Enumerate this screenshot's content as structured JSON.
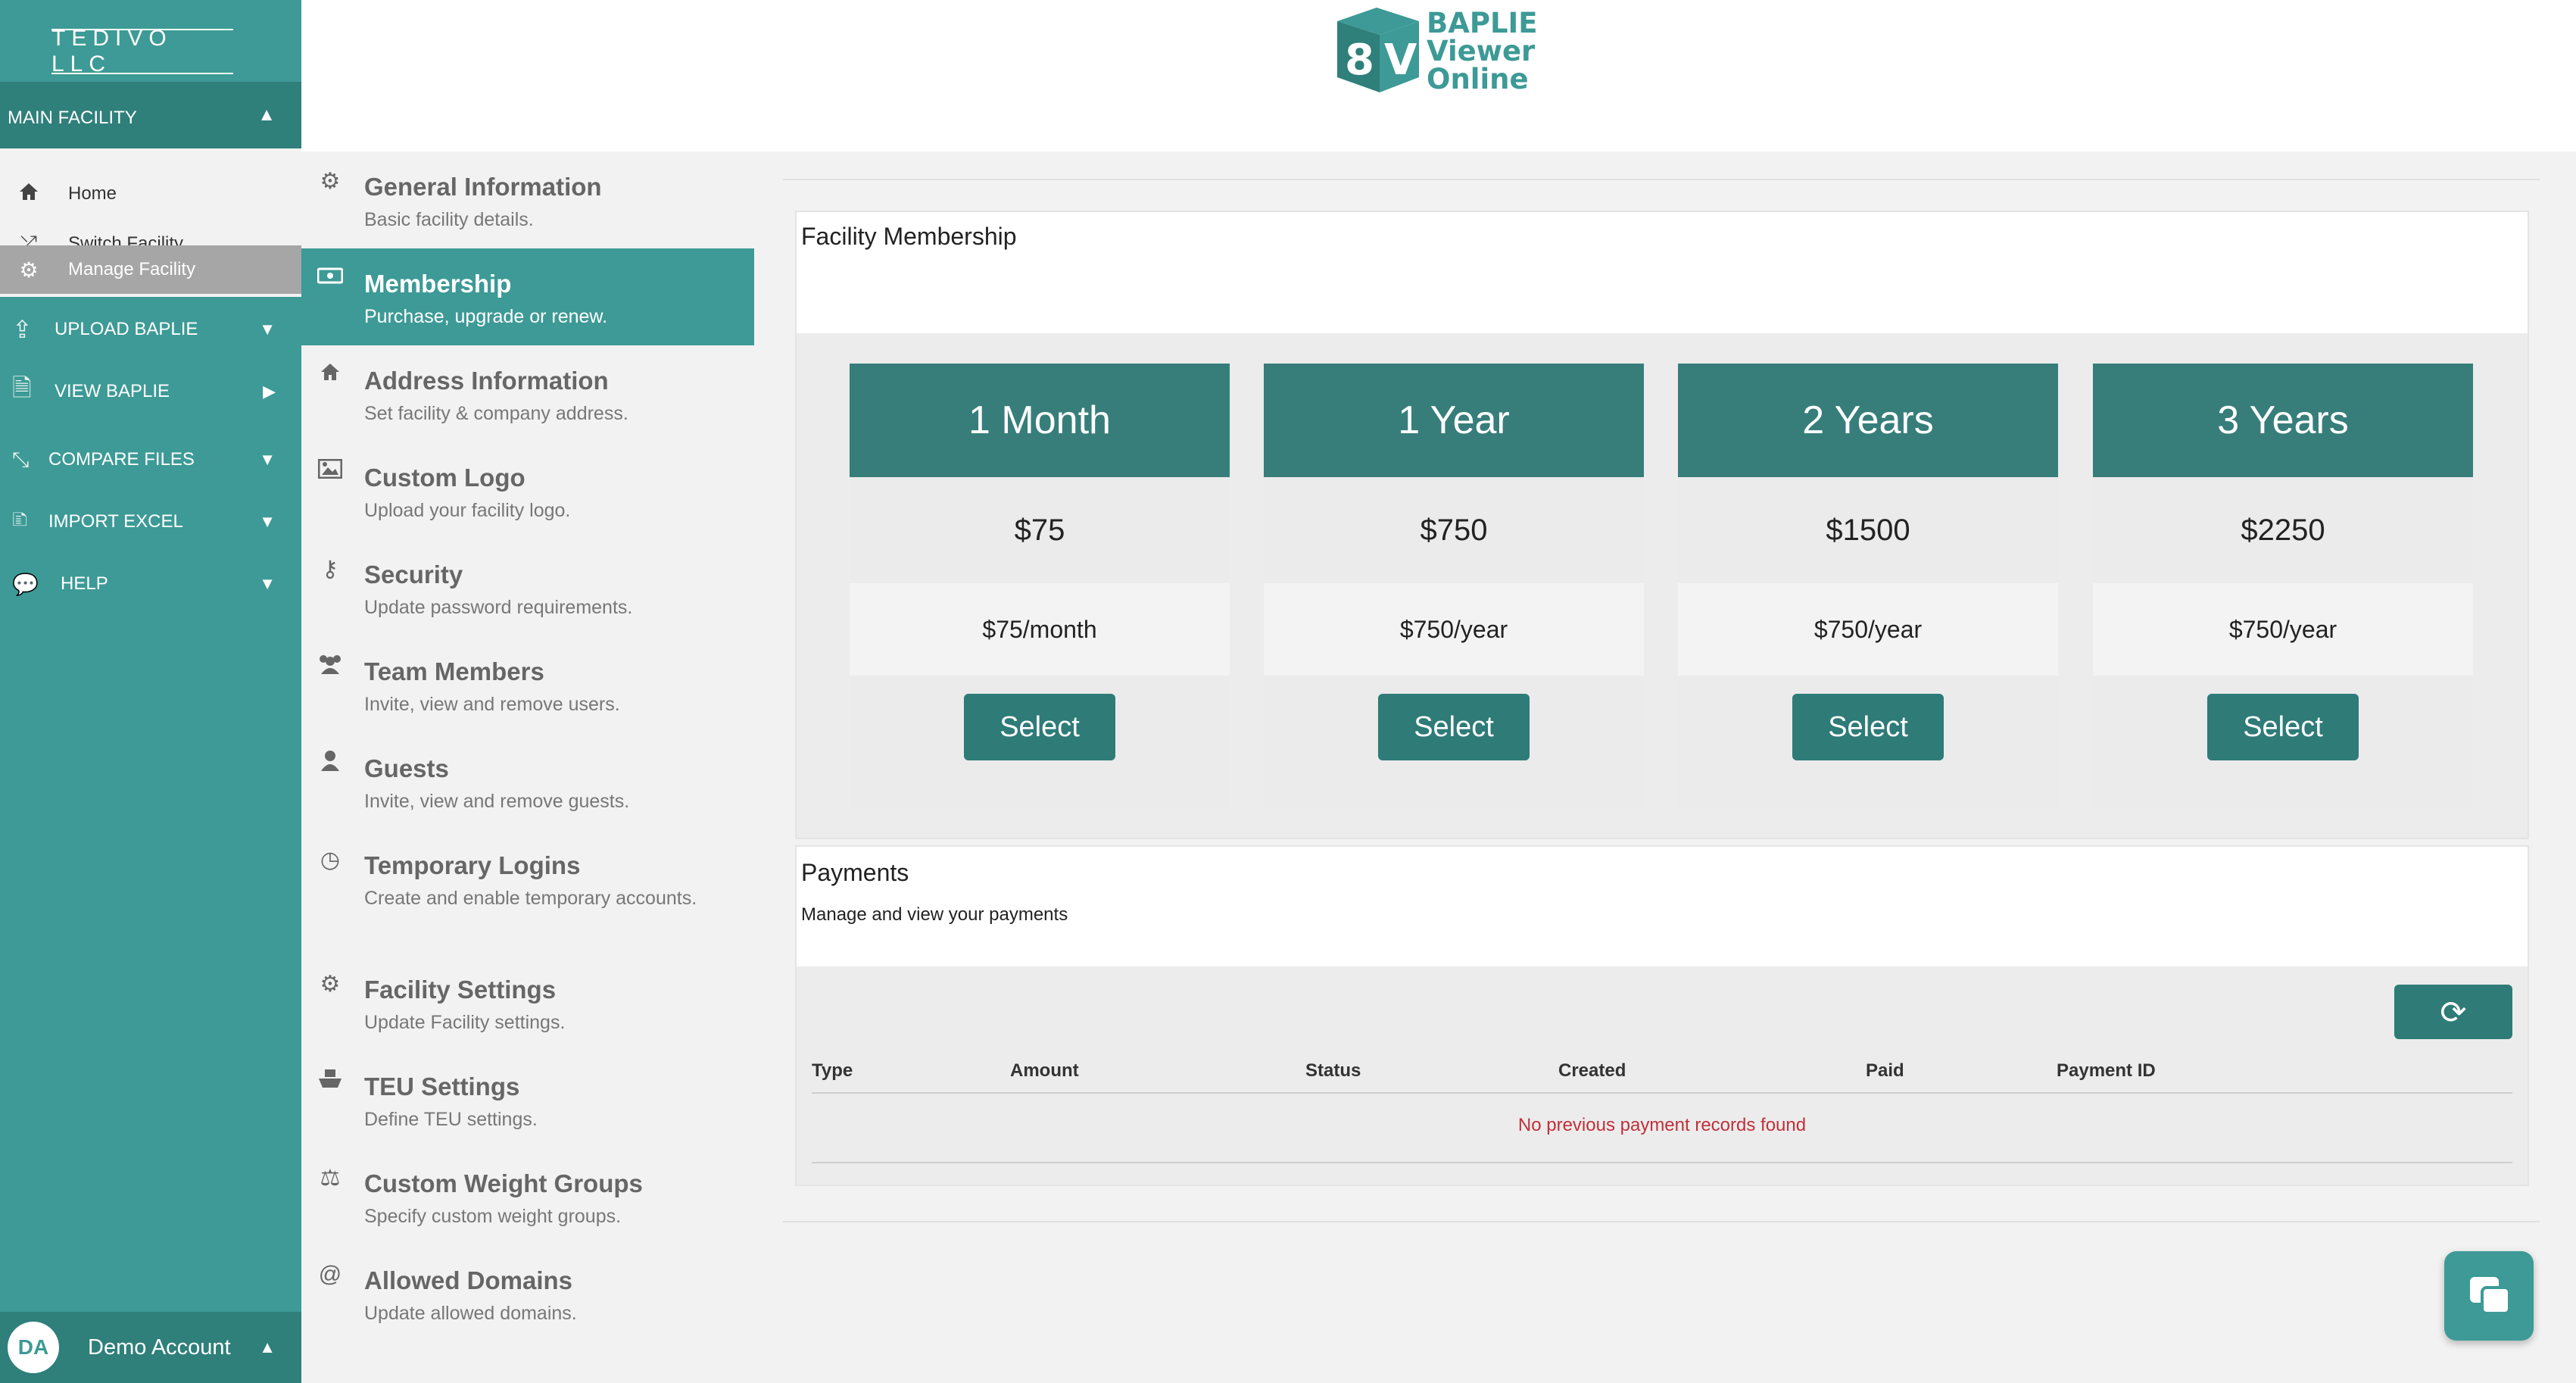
{
  "sidebar": {
    "brand": "TEDIVO LLC",
    "facility_label": "MAIN FACILITY",
    "facility_items": [
      {
        "label": "Home",
        "icon": "home-icon"
      },
      {
        "label": "Switch Facility",
        "icon": "shuffle-icon"
      },
      {
        "label": "Manage Facility",
        "icon": "gears-icon",
        "active": true
      }
    ],
    "sections": [
      {
        "label": "UPLOAD BAPLIE",
        "icon": "upload-icon"
      },
      {
        "label": "VIEW BAPLIE",
        "icon": "document-icon"
      },
      {
        "label": "COMPARE FILES",
        "icon": "compress-icon"
      },
      {
        "label": "IMPORT EXCEL",
        "icon": "excel-icon"
      },
      {
        "label": "HELP",
        "icon": "chat-bubbles-icon"
      }
    ],
    "user": {
      "initials": "DA",
      "name": "Demo Account"
    }
  },
  "header": {
    "logo_text": [
      "BAPLIE",
      "Viewer",
      "Online"
    ]
  },
  "settings_menu": [
    {
      "title": "General Information",
      "desc": "Basic facility details.",
      "icon": "gear-icon"
    },
    {
      "title": "Membership",
      "desc": "Purchase, upgrade or renew.",
      "icon": "money-icon",
      "active": true
    },
    {
      "title": "Address Information",
      "desc": "Set facility & company address.",
      "icon": "home-icon"
    },
    {
      "title": "Custom Logo",
      "desc": "Upload your facility logo.",
      "icon": "image-icon"
    },
    {
      "title": "Security",
      "desc": "Update password requirements.",
      "icon": "key-icon"
    },
    {
      "title": "Team Members",
      "desc": "Invite, view and remove users.",
      "icon": "users-icon"
    },
    {
      "title": "Guests",
      "desc": "Invite, view and remove guests.",
      "icon": "user-icon"
    },
    {
      "title": "Temporary Logins",
      "desc": "Create and enable temporary accounts.",
      "icon": "clock-icon"
    },
    {
      "title": "Facility Settings",
      "desc": "Update Facility settings.",
      "icon": "gears-icon"
    },
    {
      "title": "TEU Settings",
      "desc": "Define TEU settings.",
      "icon": "ship-icon"
    },
    {
      "title": "Custom Weight Groups",
      "desc": "Specify custom weight groups.",
      "icon": "scale-icon"
    },
    {
      "title": "Allowed Domains",
      "desc": "Update allowed domains.",
      "icon": "at-icon"
    }
  ],
  "membership": {
    "title": "Facility Membership",
    "plans": [
      {
        "name": "1 Month",
        "price": "$75",
        "rate": "$75/month",
        "button": "Select"
      },
      {
        "name": "1 Year",
        "price": "$750",
        "rate": "$750/year",
        "button": "Select"
      },
      {
        "name": "2 Years",
        "price": "$1500",
        "rate": "$750/year",
        "button": "Select"
      },
      {
        "name": "3 Years",
        "price": "$2250",
        "rate": "$750/year",
        "button": "Select"
      }
    ]
  },
  "payments": {
    "title": "Payments",
    "subtitle": "Manage and view your payments",
    "columns": [
      "Type",
      "Amount",
      "Status",
      "Created",
      "Paid",
      "Payment ID"
    ],
    "empty_message": "No previous payment records found"
  },
  "colors": {
    "brand_teal": "#3d9a96",
    "dark_teal": "#2f7f7b",
    "error_red": "#c0303a"
  }
}
